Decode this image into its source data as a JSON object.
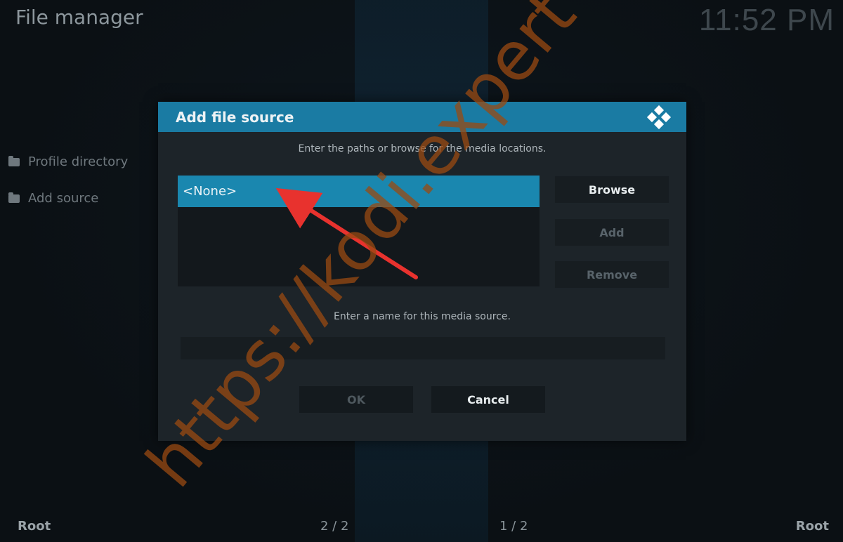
{
  "app": {
    "title": "File manager",
    "clock": "11:52 PM"
  },
  "sidebar": {
    "items": [
      {
        "label": "Profile directory",
        "icon": "folder-icon"
      },
      {
        "label": "Add source",
        "icon": "folder-icon"
      }
    ]
  },
  "footer": {
    "left": "Root",
    "center_left": "2 / 2",
    "center_right": "1 / 2",
    "right": "Root"
  },
  "dialog": {
    "title": "Add file source",
    "logo": "kodi-logo-icon",
    "paths_hint": "Enter the paths or browse for the media locations.",
    "paths": [
      "<None>"
    ],
    "buttons": {
      "browse": "Browse",
      "add": "Add",
      "remove": "Remove"
    },
    "name_hint": "Enter a name for this media source.",
    "name_value": "",
    "ok": "OK",
    "cancel": "Cancel"
  },
  "watermark": "https://kodi.expert",
  "colors": {
    "accent": "#1a7ba3",
    "selection": "#1a87af",
    "arrow": "#e8322e",
    "watermark": "#9a4a12"
  }
}
